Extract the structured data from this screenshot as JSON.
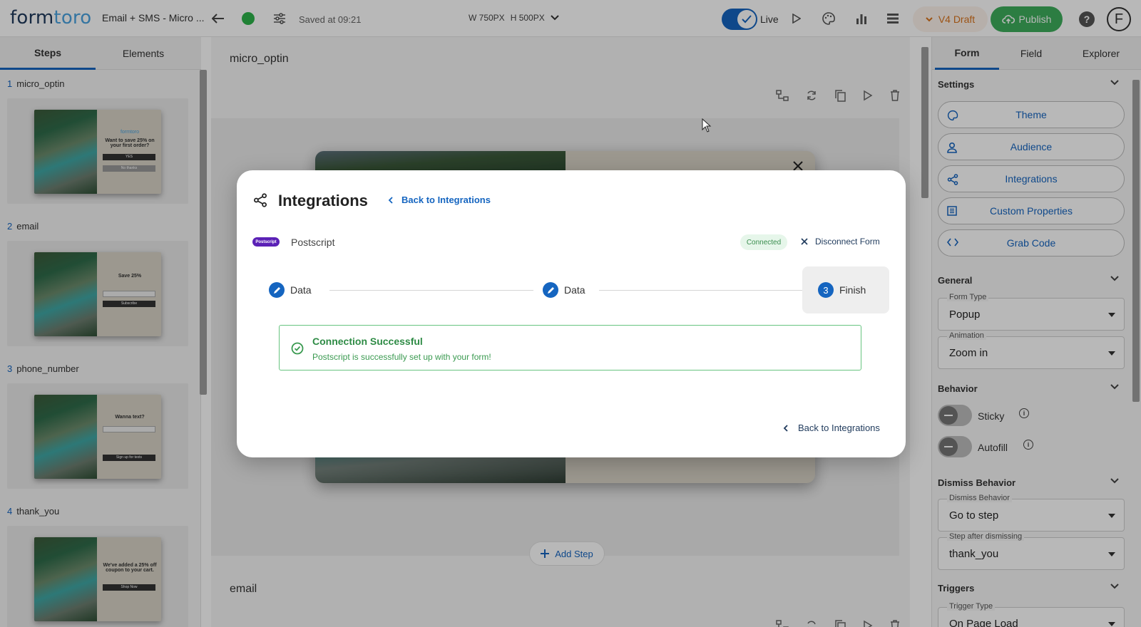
{
  "topbar": {
    "logo_main": "form",
    "logo_accent": "toro",
    "form_title": "Email + SMS - Micro ...",
    "saved_text": "Saved at 09:21",
    "dims": {
      "w": "W 750PX",
      "h": "H 500PX"
    },
    "live_label": "Live",
    "version_label": "V4 Draft",
    "publish_label": "Publish",
    "avatar_initial": "F",
    "colors": {
      "accent": "#1565c0",
      "publish": "#3dae5c",
      "status_dot": "#2db34a"
    }
  },
  "left_panel": {
    "tabs": [
      "Steps",
      "Elements"
    ],
    "steps": [
      {
        "num": "1",
        "name": "micro_optin",
        "thumb_title": "Want to save 25% on your first order?",
        "thumb_btn": "YES",
        "thumb_btn2": "No thanks"
      },
      {
        "num": "2",
        "name": "email",
        "thumb_title": "Save 25%",
        "thumb_btn": "Subscribe"
      },
      {
        "num": "3",
        "name": "phone_number",
        "thumb_title": "Wanna text?",
        "thumb_btn": "Sign up for texts"
      },
      {
        "num": "4",
        "name": "thank_you",
        "thumb_title": "We've added a 25% off coupon to your cart.",
        "thumb_btn": "Shop Now"
      }
    ],
    "thumb_brand": "formtoro"
  },
  "center": {
    "step1_name": "micro_optin",
    "step2_name": "email",
    "add_step_label": "Add Step"
  },
  "modal": {
    "title": "Integrations",
    "back_link": "Back to Integrations",
    "provider_logo_text": "Postscript",
    "provider_name": "Postscript",
    "status_badge": "Connected",
    "disconnect_label": "Disconnect Form",
    "steps": [
      {
        "label": "Data",
        "state": "done"
      },
      {
        "label": "Data",
        "state": "done"
      },
      {
        "num": "3",
        "label": "Finish",
        "state": "active"
      }
    ],
    "success_title": "Connection Successful",
    "success_message": "Postscript is successfully set up with your form!",
    "bottom_back_link": "Back to Integrations"
  },
  "right_panel": {
    "tabs": [
      "Form",
      "Field",
      "Explorer"
    ],
    "settings_title": "Settings",
    "settings_buttons": [
      {
        "label": "Theme",
        "icon": "palette-icon"
      },
      {
        "label": "Audience",
        "icon": "person-icon"
      },
      {
        "label": "Integrations",
        "icon": "share-icon"
      },
      {
        "label": "Custom Properties",
        "icon": "list-icon"
      },
      {
        "label": "Grab Code",
        "icon": "code-icon"
      }
    ],
    "general_title": "General",
    "form_type": {
      "label": "Form Type",
      "value": "Popup"
    },
    "animation": {
      "label": "Animation",
      "value": "Zoom in"
    },
    "behavior_title": "Behavior",
    "sticky_label": "Sticky",
    "autofill_label": "Autofill",
    "dismiss_title": "Dismiss Behavior",
    "dismiss_behavior": {
      "label": "Dismiss Behavior",
      "value": "Go to step"
    },
    "step_after": {
      "label": "Step after dismissing",
      "value": "thank_you"
    },
    "triggers_title": "Triggers",
    "trigger_type": {
      "label": "Trigger Type",
      "value": "On Page Load"
    }
  }
}
